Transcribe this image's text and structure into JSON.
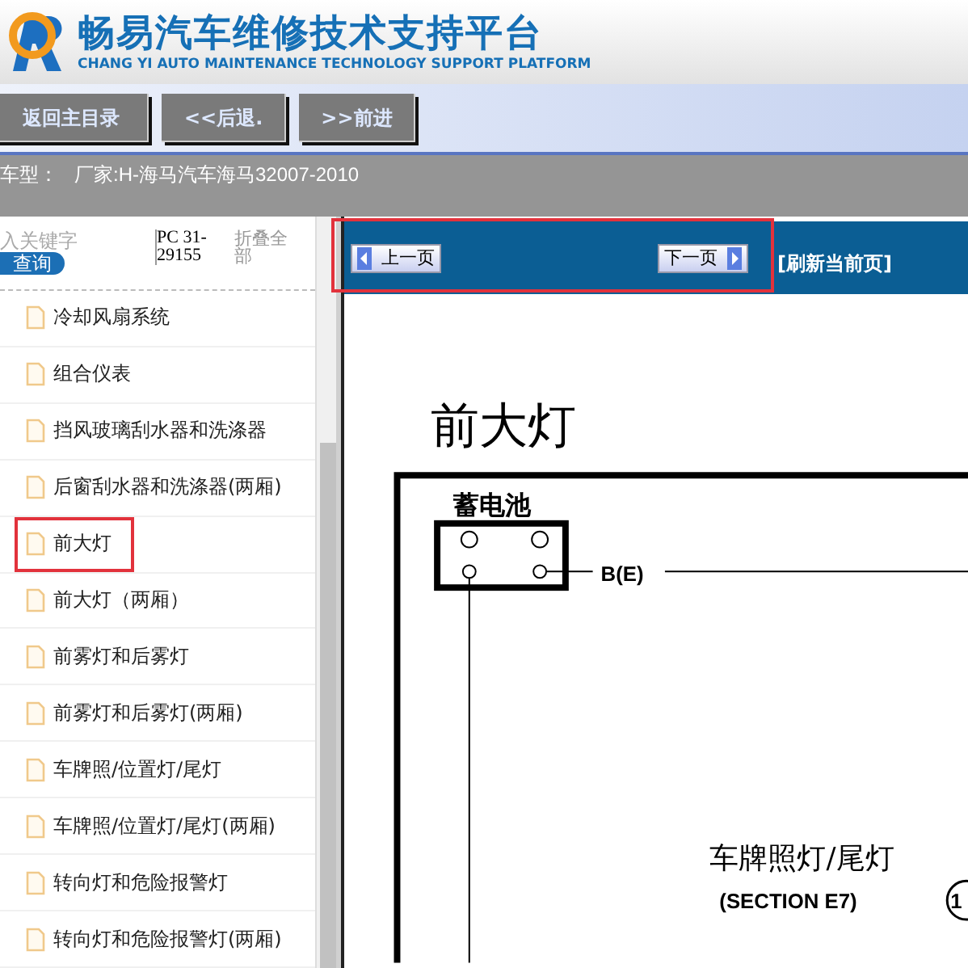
{
  "header": {
    "title": "畅易汽车维修技术支持平台",
    "subtitle": "CHANG YI AUTO MAINTENANCE TECHNOLOGY SUPPORT PLATFORM"
  },
  "nav_buttons": [
    "返回主目录",
    "<<后退.",
    ">>前进"
  ],
  "info_bar": {
    "label": "车型：",
    "value": "厂家:H-海马汽车海马32007-2010"
  },
  "sidebar": {
    "search": {
      "placeholder": "入关键字"
    },
    "search_button": "查询",
    "code": "PC 31-29155",
    "collapse_link": "折叠全部",
    "items": [
      {
        "label": "冷却风扇系统",
        "selected": false
      },
      {
        "label": "组合仪表",
        "selected": false
      },
      {
        "label": "挡风玻璃刮水器和洗涤器",
        "selected": false
      },
      {
        "label": "后窗刮水器和洗涤器(两厢)",
        "selected": false
      },
      {
        "label": "前大灯",
        "selected": true
      },
      {
        "label": "前大灯（两厢）",
        "selected": false
      },
      {
        "label": "前雾灯和后雾灯",
        "selected": false
      },
      {
        "label": "前雾灯和后雾灯(两厢)",
        "selected": false
      },
      {
        "label": "车牌照/位置灯/尾灯",
        "selected": false
      },
      {
        "label": "车牌照/位置灯/尾灯(两厢)",
        "selected": false
      },
      {
        "label": "转向灯和危险报警灯",
        "selected": false
      },
      {
        "label": "转向灯和危险报警灯(两厢)",
        "selected": false
      }
    ]
  },
  "toolbar": {
    "prev": "上一页",
    "next": "下一页",
    "refresh": "[刷新当前页]"
  },
  "diagram": {
    "title": "前大灯",
    "battery": "蓄电池",
    "wire": "B(E)",
    "component": "车牌照灯/尾灯",
    "section": "(SECTION E7)",
    "connector": "1"
  }
}
